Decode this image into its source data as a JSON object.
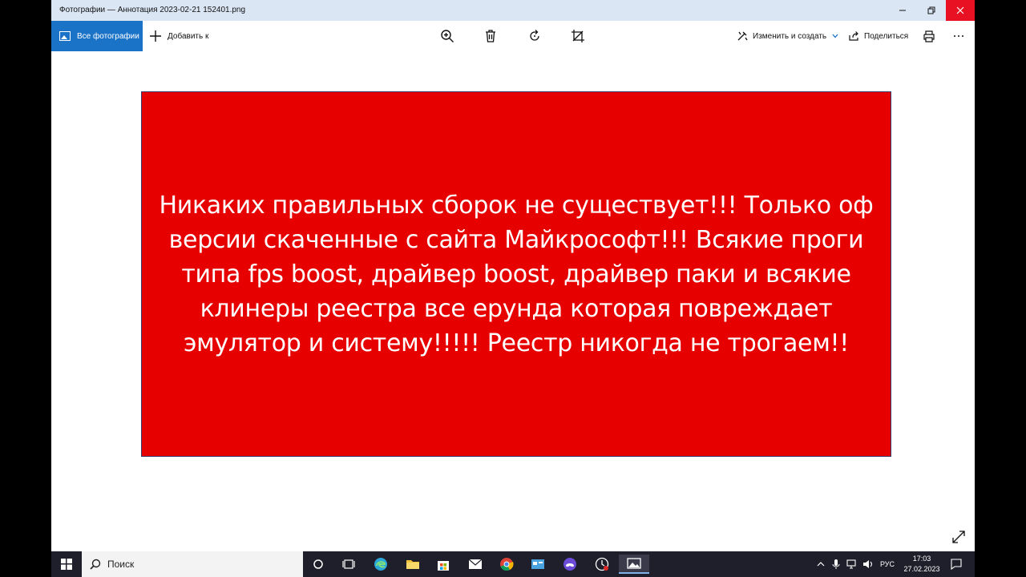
{
  "window": {
    "title": "Фотографии — Аннотация 2023-02-21 152401.png"
  },
  "toolbar": {
    "all_photos": "Все фотографии",
    "add_to": "Добавить к",
    "edit_create": "Изменить и создать",
    "share": "Поделиться"
  },
  "image": {
    "message": "Никаких правильных сборок не существует!!! Только оф версии скаченные с сайта Майкрософт!!! Всякие проги типа fps boost, драйвер boost, драйвер паки и всякие клинеры реестра все ерунда которая повреждает эмулятор и систему!!!!! Реестр никогда не трогаем!!",
    "background_color": "#e60000"
  },
  "taskbar": {
    "search_placeholder": "Поиск",
    "language": "РУС",
    "time": "17:03",
    "date": "27.02.2023"
  },
  "colors": {
    "accent": "#1b73c8",
    "close": "#e81123",
    "taskbar": "#1f1f2b"
  }
}
